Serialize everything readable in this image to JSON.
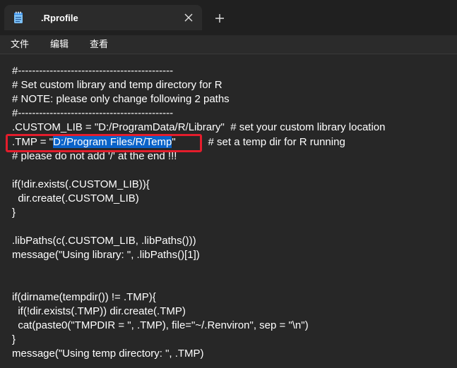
{
  "tab": {
    "title": ".Rprofile",
    "file_icon": "notepad-file-icon",
    "close_icon": "close-icon"
  },
  "new_tab_icon": "plus-icon",
  "menu": [
    {
      "label": "文件"
    },
    {
      "label": "编辑"
    },
    {
      "label": "查看"
    }
  ],
  "code": {
    "line_01": "#--------------------------------------------",
    "line_02": "# Set custom library and temp directory for R",
    "line_03": "# NOTE: please only change following 2 paths",
    "line_04": "#--------------------------------------------",
    "line_05": ".CUSTOM_LIB = \"D:/ProgramData/R/Library\"  # set your custom library location",
    "line_06_pre": ".TMP = \"",
    "line_06_sel": "D:/Program Files/R/Temp",
    "line_06_post": "\"           # set a temp dir for R running",
    "line_07": "# please do not add '/' at the end !!!",
    "line_08": "if(!dir.exists(.CUSTOM_LIB)){",
    "line_09": "  dir.create(.CUSTOM_LIB)",
    "line_10": "}",
    "line_11": ".libPaths(c(.CUSTOM_LIB, .libPaths()))",
    "line_12": "message(\"Using library: \", .libPaths()[1])",
    "line_13": "if(dirname(tempdir()) != .TMP){",
    "line_14": "  if(!dir.exists(.TMP)) dir.create(.TMP)",
    "line_15": "  cat(paste0(\"TMPDIR = \", .TMP), file=\"~/.Renviron\", sep = \"\\n\")",
    "line_16": "}",
    "line_17": "message(\"Using temp directory: \", .TMP)"
  },
  "colors": {
    "selection": "#0a63c9",
    "annotation_box": "#e41d2c",
    "editor_bg": "#272727"
  }
}
